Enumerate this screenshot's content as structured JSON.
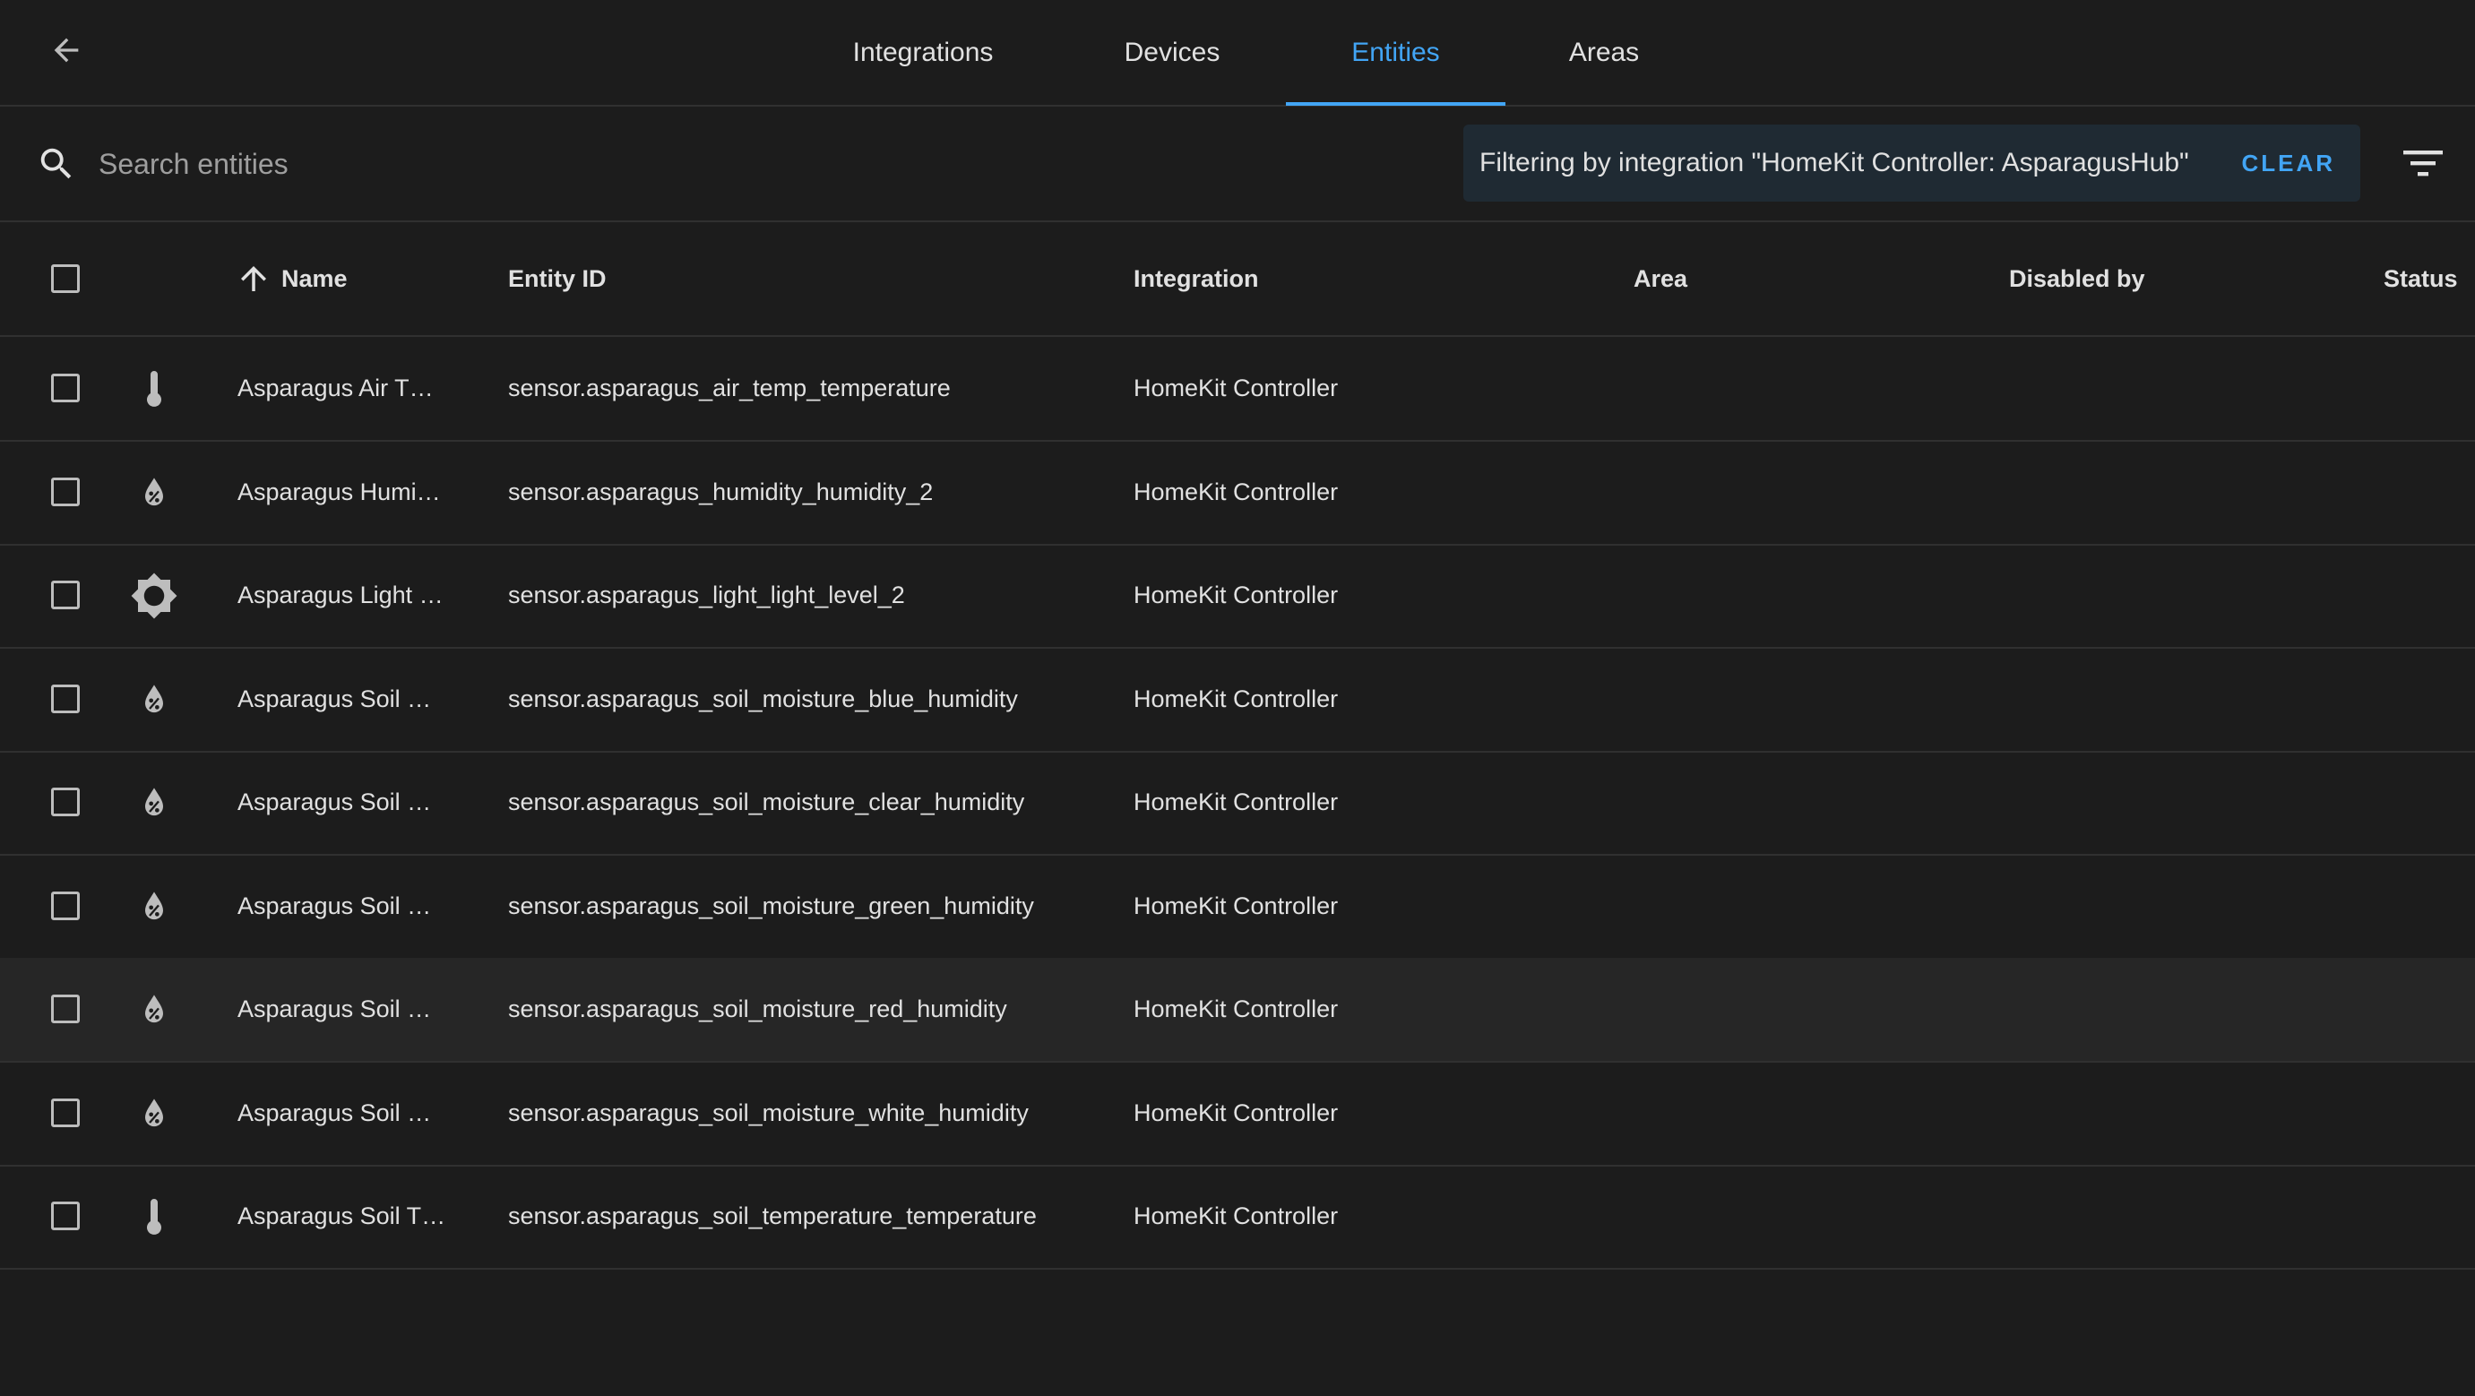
{
  "tabs": [
    {
      "label": "Integrations",
      "active": false
    },
    {
      "label": "Devices",
      "active": false
    },
    {
      "label": "Entities",
      "active": true
    },
    {
      "label": "Areas",
      "active": false
    }
  ],
  "search": {
    "placeholder": "Search entities"
  },
  "filter": {
    "text": "Filtering by integration \"HomeKit Controller: AsparagusHub\"",
    "clear_label": "CLEAR"
  },
  "table": {
    "headers": {
      "name": "Name",
      "entity_id": "Entity ID",
      "integration": "Integration",
      "area": "Area",
      "disabled_by": "Disabled by",
      "status": "Status"
    },
    "sort": {
      "column": "Name",
      "direction": "ascending"
    },
    "rows": [
      {
        "icon": "thermometer-icon",
        "name": "Asparagus Air T…",
        "entity_id": "sensor.asparagus_air_temp_temperature",
        "integration": "HomeKit Controller"
      },
      {
        "icon": "water-percent-icon",
        "name": "Asparagus Humi…",
        "entity_id": "sensor.asparagus_humidity_humidity_2",
        "integration": "HomeKit Controller"
      },
      {
        "icon": "brightness-icon",
        "name": "Asparagus Light …",
        "entity_id": "sensor.asparagus_light_light_level_2",
        "integration": "HomeKit Controller"
      },
      {
        "icon": "water-percent-icon",
        "name": "Asparagus Soil …",
        "entity_id": "sensor.asparagus_soil_moisture_blue_humidity",
        "integration": "HomeKit Controller"
      },
      {
        "icon": "water-percent-icon",
        "name": "Asparagus Soil …",
        "entity_id": "sensor.asparagus_soil_moisture_clear_humidity",
        "integration": "HomeKit Controller"
      },
      {
        "icon": "water-percent-icon",
        "name": "Asparagus Soil …",
        "entity_id": "sensor.asparagus_soil_moisture_green_humidity",
        "integration": "HomeKit Controller"
      },
      {
        "icon": "water-percent-icon",
        "name": "Asparagus Soil …",
        "entity_id": "sensor.asparagus_soil_moisture_red_humidity",
        "integration": "HomeKit Controller"
      },
      {
        "icon": "water-percent-icon",
        "name": "Asparagus Soil …",
        "entity_id": "sensor.asparagus_soil_moisture_white_humidity",
        "integration": "HomeKit Controller"
      },
      {
        "icon": "thermometer-icon",
        "name": "Asparagus Soil T…",
        "entity_id": "sensor.asparagus_soil_temperature_temperature",
        "integration": "HomeKit Controller"
      }
    ]
  },
  "colors": {
    "accent": "#42a5f5",
    "background": "#1c1c1c",
    "chip": "#1f2a33"
  }
}
